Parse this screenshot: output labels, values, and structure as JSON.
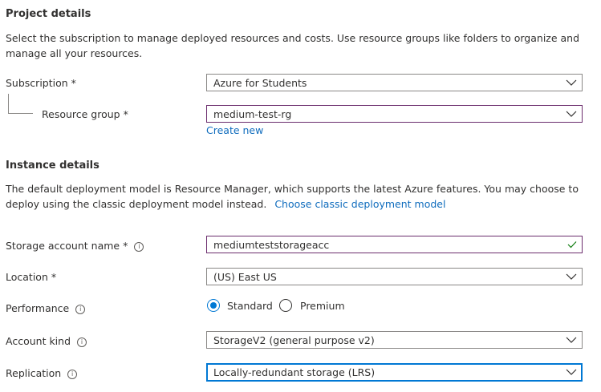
{
  "project": {
    "heading": "Project details",
    "description": "Select the subscription to manage deployed resources and costs. Use resource groups like folders to organize and manage all your resources.",
    "subscription_label": "Subscription *",
    "subscription_value": "Azure for Students",
    "resource_group_label": "Resource group *",
    "resource_group_value": "medium-test-rg",
    "create_new": "Create new"
  },
  "instance": {
    "heading": "Instance details",
    "description": "The default deployment model is Resource Manager, which supports the latest Azure features. You may choose to deploy using the classic deployment model instead.",
    "classic_link": "Choose classic deployment model",
    "storage_name_label": "Storage account name *",
    "storage_name_value": "mediumteststorageacc",
    "location_label": "Location *",
    "location_value": "(US) East US",
    "performance_label": "Performance",
    "performance_options": [
      "Standard",
      "Premium"
    ],
    "performance_selected": "Standard",
    "account_kind_label": "Account kind",
    "account_kind_value": "StorageV2 (general purpose v2)",
    "replication_label": "Replication",
    "replication_value": "Locally-redundant storage (LRS)"
  },
  "icons": {
    "info": "info-icon",
    "dropdown": "chevron-down-icon",
    "valid": "checkmark-icon"
  },
  "colors": {
    "link": "#0f6cbd",
    "focus_border": "#0078d4",
    "active_border": "#6b2d6d",
    "valid_check": "#107c10"
  }
}
